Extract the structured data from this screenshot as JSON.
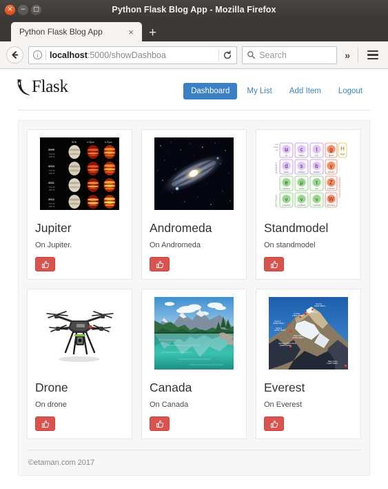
{
  "window": {
    "title": "Python Flask Blog App - Mozilla Firefox",
    "close_glyph": "×",
    "minimize_glyph": "−",
    "maximize_glyph": "□"
  },
  "browser": {
    "tab": {
      "title": "Python Flask Blog App",
      "close_glyph": "×"
    },
    "new_tab_glyph": "+",
    "url": {
      "host": "localhost",
      "path": ":5000/showDashboa"
    },
    "info_glyph": "i",
    "search": {
      "placeholder": "Search"
    },
    "overflow_glyph": "»"
  },
  "site": {
    "brand": "Flask",
    "nav": [
      {
        "label": "Dashboard",
        "active": true
      },
      {
        "label": "My List",
        "active": false
      },
      {
        "label": "Add Item",
        "active": false
      },
      {
        "label": "Logout",
        "active": false
      }
    ],
    "footer": "©etaman.com 2017"
  },
  "cards": [
    {
      "title": "Jupiter",
      "desc": "On Jupiter.",
      "image": "jupiter-infrared-thumbnail",
      "like_icon": "thumbs-up-icon"
    },
    {
      "title": "Andromeda",
      "desc": "On Andromeda",
      "image": "andromeda-galaxy-thumbnail",
      "like_icon": "thumbs-up-icon"
    },
    {
      "title": "Standmodel",
      "desc": "On standmodel",
      "image": "standard-model-chart-thumbnail",
      "like_icon": "thumbs-up-icon"
    },
    {
      "title": "Drone",
      "desc": "On drone",
      "image": "quadcopter-drone-thumbnail",
      "like_icon": "thumbs-up-icon"
    },
    {
      "title": "Canada",
      "desc": "On Canada",
      "image": "canada-lake-mountain-thumbnail",
      "like_icon": "thumbs-up-icon"
    },
    {
      "title": "Everest",
      "desc": "On Everest",
      "image": "mount-everest-route-thumbnail",
      "like_icon": "thumbs-up-icon"
    }
  ],
  "colors": {
    "nav_active": "#3b7fc4",
    "nav_link": "#3a87c8",
    "like_button": "#d9534f",
    "panel_bg": "#f7f7f7"
  }
}
